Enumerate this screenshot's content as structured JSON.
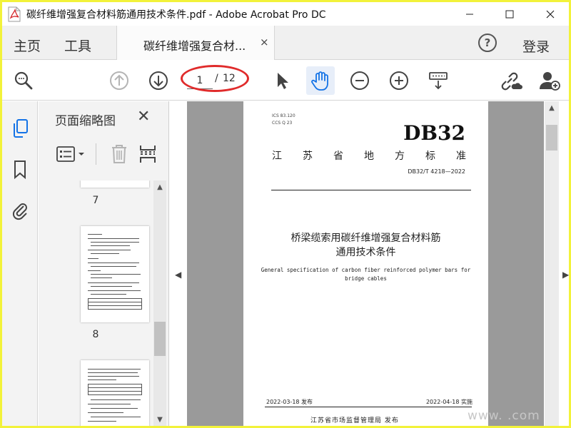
{
  "window": {
    "title": "碳纤维增强复合材料筋通用技术条件.pdf - Adobe Acrobat Pro DC"
  },
  "tabs": {
    "home": "主页",
    "tools": "工具",
    "document": "碳纤维增强复合材...",
    "close_glyph": "×"
  },
  "header": {
    "help": "?",
    "login": "登录"
  },
  "toolbar": {
    "current_page": "1",
    "separator": "/",
    "total_pages": "12"
  },
  "panel": {
    "title": "页面缩略图",
    "close_glyph": "✕",
    "thumbnails": [
      {
        "label": "7"
      },
      {
        "label": "8"
      }
    ]
  },
  "document_page": {
    "ics": "ICS 83.120",
    "ccs": "CCS Q 23",
    "code": "DB32",
    "province": "江苏省地方标准",
    "standard_number": "DB32/T 4218—2022",
    "title_line1": "桥梁缆索用碳纤维增强复合材料筋",
    "title_line2": "通用技术条件",
    "english_line1": "General specification of carbon fiber reinforced polymer bars for",
    "english_line2": "bridge cables",
    "issue_date": "2022-03-18 发布",
    "implement_date": "2022-04-18 实施",
    "publisher": "江苏省市场监督管理局    发布"
  },
  "watermark": "www.     .com",
  "colors": {
    "accent_blue": "#1473e6",
    "annotation_red": "#e02b2b",
    "outer_frame": "#f2f23a",
    "canvas_gray": "#9a9a9a"
  }
}
